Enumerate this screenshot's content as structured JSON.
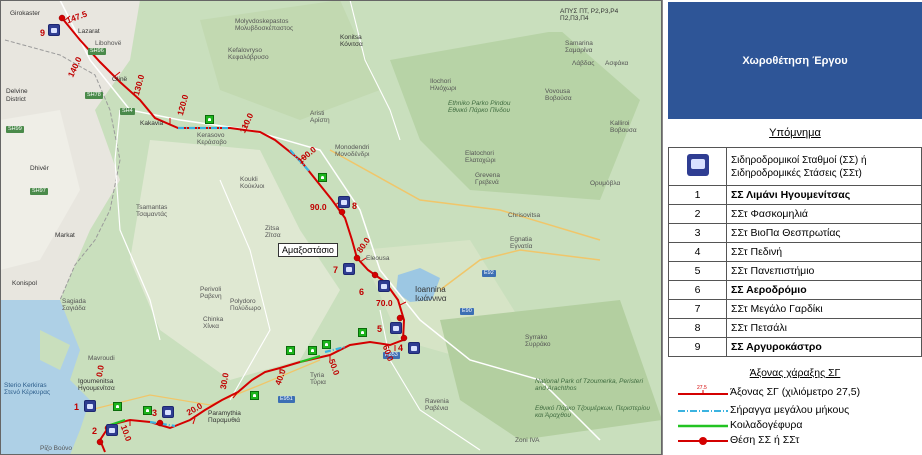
{
  "map": {
    "km_labels": [
      "147.5",
      "140.0",
      "130.0",
      "120.0",
      "110.0",
      "100.0",
      "90.0",
      "80.0",
      "70.0",
      "60.0",
      "50.0",
      "40.0",
      "30.0",
      "20.0",
      "10.0",
      "0.0"
    ],
    "station_numbers": [
      "9",
      "8",
      "7",
      "6",
      "5",
      "4",
      "3",
      "2",
      "1"
    ],
    "callout": "Αμαξοστάσιο",
    "places": [
      {
        "t": "Girokaster"
      },
      {
        "t": "Lazarat"
      },
      {
        "t": "Libohovë"
      },
      {
        "t": "Delvine"
      },
      {
        "t": "District"
      },
      {
        "t": "Glinë"
      },
      {
        "t": "Kakavia"
      },
      {
        "t": "Dhivër"
      },
      {
        "t": "Markat"
      },
      {
        "t": "Konispol"
      },
      {
        "t": "Molyvdoskepastos"
      },
      {
        "t": "Μολυβδοσκέπαστος"
      },
      {
        "t": "Κεφαλόβρυσο"
      },
      {
        "t": "Kefalovryso"
      },
      {
        "t": "Kerasovo"
      },
      {
        "t": "Κεράσοβο"
      },
      {
        "t": "Aristi"
      },
      {
        "t": "Αρίστη"
      },
      {
        "t": "Monodendri"
      },
      {
        "t": "Μονοδένδρι"
      },
      {
        "t": "Koukli"
      },
      {
        "t": "Κούκλιοι"
      },
      {
        "t": "Tsamantas"
      },
      {
        "t": "Τσαμαντάς"
      },
      {
        "t": "Zitsa"
      },
      {
        "t": "Ζίτσα"
      },
      {
        "t": "Perivoli"
      },
      {
        "t": "Ραβενη"
      },
      {
        "t": "Polydoro"
      },
      {
        "t": "Πολύδωρο"
      },
      {
        "t": "Chinka"
      },
      {
        "t": "Χίνκα"
      },
      {
        "t": "Tyria"
      },
      {
        "t": "Τύρια"
      },
      {
        "t": "Mavroudi"
      },
      {
        "t": "Sagiada"
      },
      {
        "t": "Σαγιάδα"
      },
      {
        "t": "Igoumenitsa"
      },
      {
        "t": "Ηγουμενίτσα"
      },
      {
        "t": "Paramythia"
      },
      {
        "t": "Παραμυθιά"
      },
      {
        "t": "Sterio Kerkiras"
      },
      {
        "t": "Στενό Κέρκυρας"
      },
      {
        "t": "Konitsa"
      },
      {
        "t": "Κόνιτσα"
      },
      {
        "t": "Ilochori"
      },
      {
        "t": "Ηλιόχωρι"
      },
      {
        "t": "Ethniko Parko Pindou"
      },
      {
        "t": "Εθνικό Πάρκο Πίνδου"
      },
      {
        "t": "Elatochori"
      },
      {
        "t": "Ελατοχώρι"
      },
      {
        "t": "Grevena"
      },
      {
        "t": "Γρεβενά"
      },
      {
        "t": "Chrisovitsa"
      },
      {
        "t": "Egnatia"
      },
      {
        "t": "Εγνατία"
      },
      {
        "t": "Ioannina"
      },
      {
        "t": "Ιωάννινα"
      },
      {
        "t": "Eleousa"
      },
      {
        "t": "Syrrako"
      },
      {
        "t": "Συρράκο"
      },
      {
        "t": "Ravenia"
      },
      {
        "t": "Ραβένια"
      },
      {
        "t": "National Park of Tzoumerka, Peristeri and Arachthos"
      },
      {
        "t": "Εθνικό Πάρκο Τζουμέρκων, Περιστερίου και Άραχθου"
      },
      {
        "t": "Ζoni IVA"
      },
      {
        "t": "Ρίζο Βούνο"
      },
      {
        "t": "Samarina"
      },
      {
        "t": "Σαμαρίνα"
      },
      {
        "t": "Vovousa"
      },
      {
        "t": "Βοβούσα"
      },
      {
        "t": "Λάβδας"
      },
      {
        "t": "Ασφάκα"
      },
      {
        "t": "Kalliroi"
      },
      {
        "t": "Βοβουσα"
      },
      {
        "t": "Ορυμόβλα"
      }
    ],
    "roads": [
      "SH96",
      "SH4",
      "SH78",
      "SH99",
      "SH97",
      "E92",
      "E90",
      "E951",
      "E853"
    ],
    "corner_text": "ΑΠΥΣ ΠΤ, Ρ2,Ρ3,Ρ4 Π2,Π3,Π4",
    "colors": {
      "alignment": "#d40000",
      "tunnel": "#3bb3e0",
      "bridge": "#22c322",
      "station": "#2f3d92"
    }
  },
  "legend": {
    "title": "Χωροθέτηση Έργου",
    "heading": "Υπόμνημα",
    "header_row": "Σιδηροδρομικοί Σταθμοί (ΣΣ) ή Σιδηροδρομικές Στάσεις (ΣΣτ)",
    "rows": [
      {
        "num": "1",
        "name": "ΣΣ Λιμάνι Ηγουμενίτσας",
        "bold": true
      },
      {
        "num": "2",
        "name": "ΣΣτ Φασκομηλιά",
        "bold": false
      },
      {
        "num": "3",
        "name": "ΣΣτ ΒιοΠα Θεσπρωτίας",
        "bold": false
      },
      {
        "num": "4",
        "name": "ΣΣτ Πεδινή",
        "bold": false
      },
      {
        "num": "5",
        "name": "ΣΣτ Πανεπιστήμιο",
        "bold": false
      },
      {
        "num": "6",
        "name": "ΣΣ Αεροδρόμιο",
        "bold": true
      },
      {
        "num": "7",
        "name": "ΣΣτ Μεγάλο Γαρδίκι",
        "bold": false
      },
      {
        "num": "8",
        "name": "ΣΣτ Πετσάλι",
        "bold": false
      },
      {
        "num": "9",
        "name": "ΣΣ Αργυροκάστρο",
        "bold": true
      }
    ],
    "axes_title": "Άξονας χάραξης ΣΓ",
    "axis_items": [
      {
        "sample": "27.5",
        "label": "Άξονας ΣΓ (χιλιόμετρο 27,5)"
      },
      {
        "label": "Σήραγγα μεγάλου μήκους"
      },
      {
        "label": "Κοιλαδογέφυρα"
      },
      {
        "label": "Θέση ΣΣ ή ΣΣτ"
      }
    ]
  }
}
